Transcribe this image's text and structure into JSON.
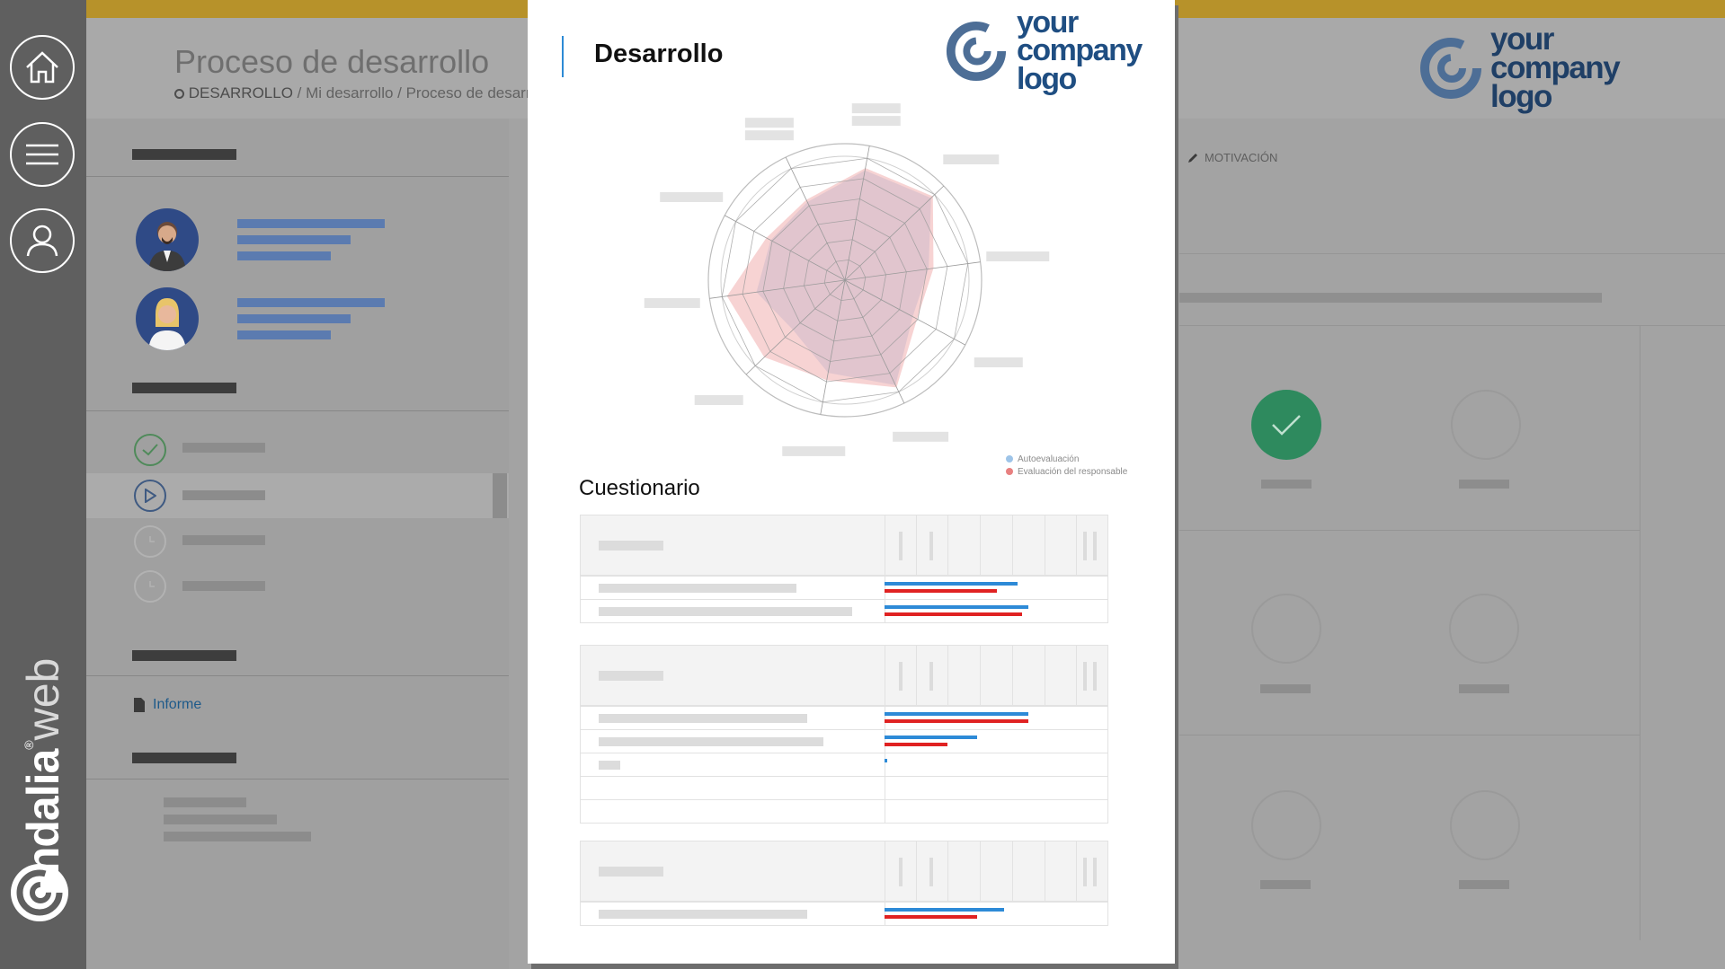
{
  "app": {
    "page_title": "Proceso de desarrollo",
    "breadcrumb": {
      "first": "DESARROLLO",
      "separator": " / ",
      "second": "Mi desarrollo",
      "third": "Proceso de desarrollo"
    },
    "left_panel": {
      "report_link": "Informe"
    },
    "right_panel": {
      "tab_label": "MOTIVACIÓN",
      "logo_line1": "your",
      "logo_line2": "company",
      "logo_line3": "logo"
    },
    "brand": {
      "name": "endalia",
      "suffix": "web",
      "registered": "®"
    }
  },
  "sidebar": {
    "items": [
      {
        "icon": "home-icon"
      },
      {
        "icon": "menu-icon"
      },
      {
        "icon": "user-icon"
      }
    ]
  },
  "document": {
    "title": "Desarrollo",
    "logo_line1": "your",
    "logo_line2": "company",
    "logo_line3": "logo",
    "section_title": "Cuestionario",
    "legend": {
      "self": "Autoevaluación",
      "manager": "Evaluación del responsable"
    },
    "colors": {
      "self": "#9ec4e8",
      "manager": "#e88080",
      "bar_blue": "#2d8ad7",
      "bar_red": "#e02222",
      "accent": "#2c8ad5",
      "brand_yellow": "#b7922a",
      "success": "#2e8a5e"
    }
  },
  "chart_data": {
    "type": "radar",
    "axes_count": 10,
    "rings": 6,
    "series": [
      {
        "values": [
          0.9,
          0.96,
          0.68,
          0.62,
          0.94,
          0.76,
          0.58,
          0.72,
          0.68,
          0.7
        ]
      },
      {
        "values": [
          0.92,
          0.98,
          0.72,
          0.66,
          0.96,
          0.82,
          0.9,
          0.96,
          0.72,
          0.72
        ]
      }
    ],
    "bars": [
      {
        "group": 1,
        "rows": [
          {
            "self": 0.59,
            "manager": 0.5
          },
          {
            "self": 0.64,
            "manager": 0.61
          }
        ]
      },
      {
        "group": 2,
        "rows": [
          {
            "self": 0.64,
            "manager": 0.64
          },
          {
            "self": 0.41,
            "manager": 0.28
          },
          {
            "self": 0.01,
            "manager": 0
          },
          {
            "self": 0,
            "manager": 0
          },
          {
            "self": 0,
            "manager": 0
          }
        ]
      },
      {
        "group": 3,
        "rows": [
          {
            "self": 0.53,
            "manager": 0.41
          }
        ]
      }
    ]
  }
}
